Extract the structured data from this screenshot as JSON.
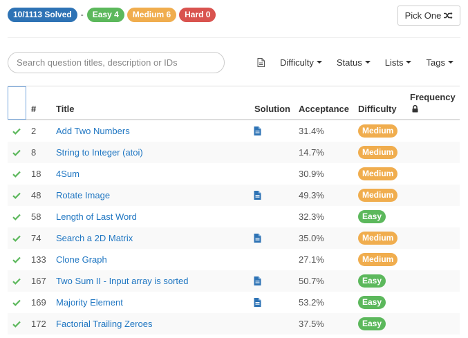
{
  "stats": {
    "solved": "10/1113 Solved",
    "separator": "-",
    "easy": "Easy 4",
    "medium": "Medium 6",
    "hard": "Hard 0"
  },
  "pick_one": {
    "label": "Pick One",
    "icon": "shuffle-icon"
  },
  "search": {
    "placeholder": "Search question titles, description or IDs"
  },
  "filters": [
    {
      "label": "Difficulty"
    },
    {
      "label": "Status"
    },
    {
      "label": "Lists"
    },
    {
      "label": "Tags"
    }
  ],
  "columns": {
    "number": "#",
    "title": "Title",
    "solution": "Solution",
    "acceptance": "Acceptance",
    "difficulty": "Difficulty",
    "frequency": "Frequency"
  },
  "colors": {
    "link": "#1f76c2",
    "check": "#5cb85c",
    "easy": "#5cb85c",
    "medium": "#f0ad4e",
    "hard": "#d9534f",
    "solved": "#2e73b5"
  },
  "rows": [
    {
      "id": "2",
      "title": "Add Two Numbers",
      "solution": true,
      "acceptance": "31.4%",
      "difficulty": "Medium",
      "level": "medium"
    },
    {
      "id": "8",
      "title": "String to Integer (atoi)",
      "solution": false,
      "acceptance": "14.7%",
      "difficulty": "Medium",
      "level": "medium"
    },
    {
      "id": "18",
      "title": "4Sum",
      "solution": false,
      "acceptance": "30.9%",
      "difficulty": "Medium",
      "level": "medium"
    },
    {
      "id": "48",
      "title": "Rotate Image",
      "solution": true,
      "acceptance": "49.3%",
      "difficulty": "Medium",
      "level": "medium"
    },
    {
      "id": "58",
      "title": "Length of Last Word",
      "solution": false,
      "acceptance": "32.3%",
      "difficulty": "Easy",
      "level": "easy"
    },
    {
      "id": "74",
      "title": "Search a 2D Matrix",
      "solution": true,
      "acceptance": "35.0%",
      "difficulty": "Medium",
      "level": "medium"
    },
    {
      "id": "133",
      "title": "Clone Graph",
      "solution": false,
      "acceptance": "27.1%",
      "difficulty": "Medium",
      "level": "medium"
    },
    {
      "id": "167",
      "title": "Two Sum II - Input array is sorted",
      "solution": true,
      "acceptance": "50.7%",
      "difficulty": "Easy",
      "level": "easy"
    },
    {
      "id": "169",
      "title": "Majority Element",
      "solution": true,
      "acceptance": "53.2%",
      "difficulty": "Easy",
      "level": "easy"
    },
    {
      "id": "172",
      "title": "Factorial Trailing Zeroes",
      "solution": false,
      "acceptance": "37.5%",
      "difficulty": "Easy",
      "level": "easy"
    }
  ]
}
